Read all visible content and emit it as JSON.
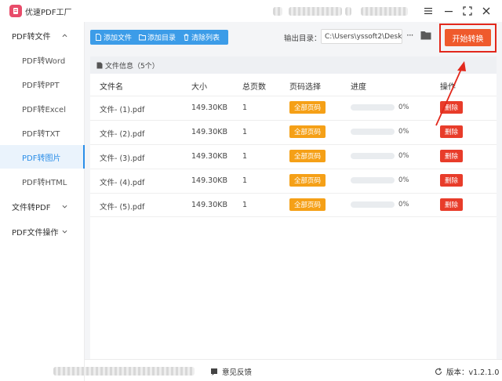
{
  "app": {
    "title": "优速PDF工厂"
  },
  "window_controls": [
    "menu-icon",
    "minimize-icon",
    "maximize-icon",
    "close-icon"
  ],
  "sidebar": {
    "groups": [
      {
        "label": "PDF转文件",
        "expanded": true
      },
      {
        "label": "文件转PDF",
        "expanded": false
      },
      {
        "label": "PDF文件操作",
        "expanded": false
      }
    ],
    "items": [
      {
        "label": "PDF转Word"
      },
      {
        "label": "PDF转PPT"
      },
      {
        "label": "PDF转Excel"
      },
      {
        "label": "PDF转TXT"
      },
      {
        "label": "PDF转图片",
        "active": true
      },
      {
        "label": "PDF转HTML"
      }
    ]
  },
  "toolbar": {
    "add_file": "添加文件",
    "add_dir": "添加目录",
    "clear_list": "清除列表",
    "output_label": "输出目录：",
    "output_path": "C:\\Users\\yssoft2\\Deskt",
    "more_label": "···",
    "start_label": "开始转换"
  },
  "file_info": {
    "label": "文件信息（5个）"
  },
  "table": {
    "headers": [
      "文件名",
      "大小",
      "总页数",
      "页码选择",
      "进度",
      "操作"
    ],
    "rows": [
      {
        "name": "文件- (1).pdf",
        "size": "149.30KB",
        "pages": "1",
        "page_select": "全部页码",
        "progress": "0%",
        "action": "删除"
      },
      {
        "name": "文件- (2).pdf",
        "size": "149.30KB",
        "pages": "1",
        "page_select": "全部页码",
        "progress": "0%",
        "action": "删除"
      },
      {
        "name": "文件- (3).pdf",
        "size": "149.30KB",
        "pages": "1",
        "page_select": "全部页码",
        "progress": "0%",
        "action": "删除"
      },
      {
        "name": "文件- (4).pdf",
        "size": "149.30KB",
        "pages": "1",
        "page_select": "全部页码",
        "progress": "0%",
        "action": "删除"
      },
      {
        "name": "文件- (5).pdf",
        "size": "149.30KB",
        "pages": "1",
        "page_select": "全部页码",
        "progress": "0%",
        "action": "删除"
      }
    ]
  },
  "status": {
    "feedback": "意见反馈",
    "version": "版本：v1.2.1.0"
  },
  "colors": {
    "accent_blue": "#3c9ce8",
    "start_orange": "#ef5a2c",
    "page_btn": "#f5a017",
    "delete_red": "#e83c2a",
    "highlight_red": "#e2281c"
  }
}
